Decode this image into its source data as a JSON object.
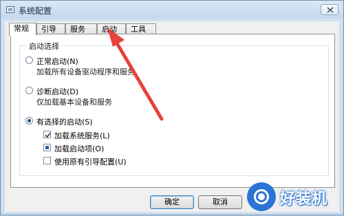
{
  "window": {
    "title": "系统配置"
  },
  "tabs": [
    {
      "label": "常规",
      "active": true
    },
    {
      "label": "引导",
      "active": false
    },
    {
      "label": "服务",
      "active": false
    },
    {
      "label": "启动",
      "active": false
    },
    {
      "label": "工具",
      "active": false
    }
  ],
  "startup_group": {
    "legend": "启动选择",
    "normal": {
      "label": "正常启动(N)",
      "description": "加载所有设备驱动程序和服务",
      "selected": false
    },
    "diagnostic": {
      "label": "诊断启动(D)",
      "description": "仅加载基本设备和服务",
      "selected": false
    },
    "selective": {
      "label": "有选择的启动(S)",
      "selected": true,
      "options": [
        {
          "label": "加载系统服务(L)",
          "state": "checked"
        },
        {
          "label": "加载启动项(O)",
          "state": "partial"
        },
        {
          "label": "使用原有引导配置(U)",
          "state": "unchecked"
        }
      ]
    }
  },
  "buttons": {
    "ok": "确定",
    "cancel": "取消"
  },
  "watermark": {
    "text": "好装机"
  },
  "colors": {
    "arrow": "#e8403a",
    "watermark": "#2b74d6"
  },
  "icons": {
    "close": "close-icon",
    "app": "system-config-icon",
    "arrow": "red-arrow-annotation"
  }
}
